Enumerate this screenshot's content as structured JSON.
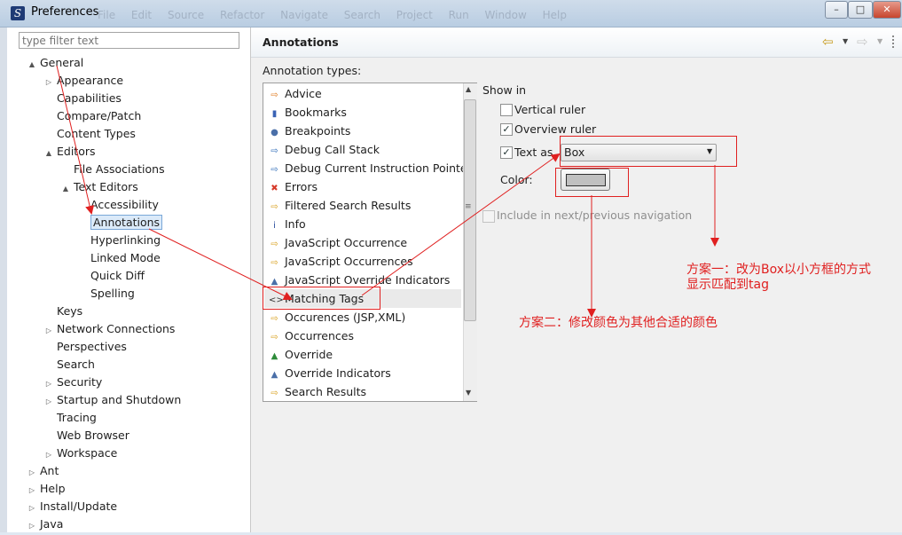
{
  "window": {
    "title": "Preferences",
    "background_menu": "File  Edit  Source  Refactor  Navigate  Search  Project  Run  Window  Help",
    "buttons": [
      "–",
      "□",
      "✕"
    ]
  },
  "filter": {
    "placeholder": "type filter text"
  },
  "tree": [
    {
      "label": "General",
      "level": 0,
      "twisty": "▲"
    },
    {
      "label": "Appearance",
      "level": 1,
      "twisty": "▷"
    },
    {
      "label": "Capabilities",
      "level": 1,
      "twisty": ""
    },
    {
      "label": "Compare/Patch",
      "level": 1,
      "twisty": ""
    },
    {
      "label": "Content Types",
      "level": 1,
      "twisty": ""
    },
    {
      "label": "Editors",
      "level": 1,
      "twisty": "▲"
    },
    {
      "label": "File Associations",
      "level": 2,
      "twisty": ""
    },
    {
      "label": "Text Editors",
      "level": 2,
      "twisty": "▲"
    },
    {
      "label": "Accessibility",
      "level": 3,
      "twisty": ""
    },
    {
      "label": "Annotations",
      "level": 3,
      "twisty": "",
      "selected": true
    },
    {
      "label": "Hyperlinking",
      "level": 3,
      "twisty": ""
    },
    {
      "label": "Linked Mode",
      "level": 3,
      "twisty": ""
    },
    {
      "label": "Quick Diff",
      "level": 3,
      "twisty": ""
    },
    {
      "label": "Spelling",
      "level": 3,
      "twisty": ""
    },
    {
      "label": "Keys",
      "level": 1,
      "twisty": ""
    },
    {
      "label": "Network Connections",
      "level": 1,
      "twisty": "▷"
    },
    {
      "label": "Perspectives",
      "level": 1,
      "twisty": ""
    },
    {
      "label": "Search",
      "level": 1,
      "twisty": ""
    },
    {
      "label": "Security",
      "level": 1,
      "twisty": "▷"
    },
    {
      "label": "Startup and Shutdown",
      "level": 1,
      "twisty": "▷"
    },
    {
      "label": "Tracing",
      "level": 1,
      "twisty": ""
    },
    {
      "label": "Web Browser",
      "level": 1,
      "twisty": ""
    },
    {
      "label": "Workspace",
      "level": 1,
      "twisty": "▷"
    },
    {
      "label": "Ant",
      "level": 0,
      "twisty": "▷"
    },
    {
      "label": "Help",
      "level": 0,
      "twisty": "▷"
    },
    {
      "label": "Install/Update",
      "level": 0,
      "twisty": "▷"
    },
    {
      "label": "Java",
      "level": 0,
      "twisty": "▷"
    }
  ],
  "page": {
    "title": "Annotations",
    "annotation_types_label": "Annotation types:",
    "nav": {
      "back_icon": "⇦",
      "forward_icon": "⇨",
      "caret": "▼"
    }
  },
  "annotation_types": [
    {
      "label": "Advice",
      "icon": "⇨",
      "icon_color": "#e07a1f"
    },
    {
      "label": "Bookmarks",
      "icon": "▮",
      "icon_color": "#3a63b5"
    },
    {
      "label": "Breakpoints",
      "icon": "●",
      "icon_color": "#4a6fa8"
    },
    {
      "label": "Debug Call Stack",
      "icon": "⇨",
      "icon_color": "#2f6db8"
    },
    {
      "label": "Debug Current Instruction Pointer",
      "icon": "⇨",
      "icon_color": "#2f6db8"
    },
    {
      "label": "Errors",
      "icon": "✖",
      "icon_color": "#d63a2a"
    },
    {
      "label": "Filtered Search Results",
      "icon": "⇨",
      "icon_color": "#d9a21f"
    },
    {
      "label": "Info",
      "icon": "i",
      "icon_color": "#2b4f9e"
    },
    {
      "label": "JavaScript Occurrence",
      "icon": "⇨",
      "icon_color": "#d9a21f"
    },
    {
      "label": "JavaScript Occurrences",
      "icon": "⇨",
      "icon_color": "#d9a21f"
    },
    {
      "label": "JavaScript Override Indicators",
      "icon": "▲",
      "icon_color": "#4a6fa8"
    },
    {
      "label": "Matching Tags",
      "icon": "<>",
      "icon_color": "#333333",
      "selected": true
    },
    {
      "label": "Occurences (JSP,XML)",
      "icon": "⇨",
      "icon_color": "#d9a21f"
    },
    {
      "label": "Occurrences",
      "icon": "⇨",
      "icon_color": "#d9a21f"
    },
    {
      "label": "Override",
      "icon": "▲",
      "icon_color": "#2e8b3a"
    },
    {
      "label": "Override Indicators",
      "icon": "▲",
      "icon_color": "#4a6fa8"
    },
    {
      "label": "Search Results",
      "icon": "⇨",
      "icon_color": "#d9a21f"
    }
  ],
  "show_in": {
    "label": "Show in",
    "vertical_ruler": {
      "label": "Vertical ruler",
      "checked": false
    },
    "overview_ruler": {
      "label": "Overview ruler",
      "checked": true
    },
    "text_as": {
      "label": "Text as",
      "checked": true,
      "value": "Box"
    },
    "color_label": "Color:",
    "color_value": "#c0c0c0",
    "include_nav": {
      "label": "Include in next/previous navigation",
      "checked": false,
      "disabled": true
    }
  },
  "notes": {
    "plan1_line1": "方案一：改为Box以小方框的方式",
    "plan1_line2": "显示匹配到tag",
    "plan2": "方案二：修改颜色为其他合适的颜色"
  },
  "colors": {
    "annotation_red": "#e02020",
    "selection": "#dbeaf9"
  }
}
